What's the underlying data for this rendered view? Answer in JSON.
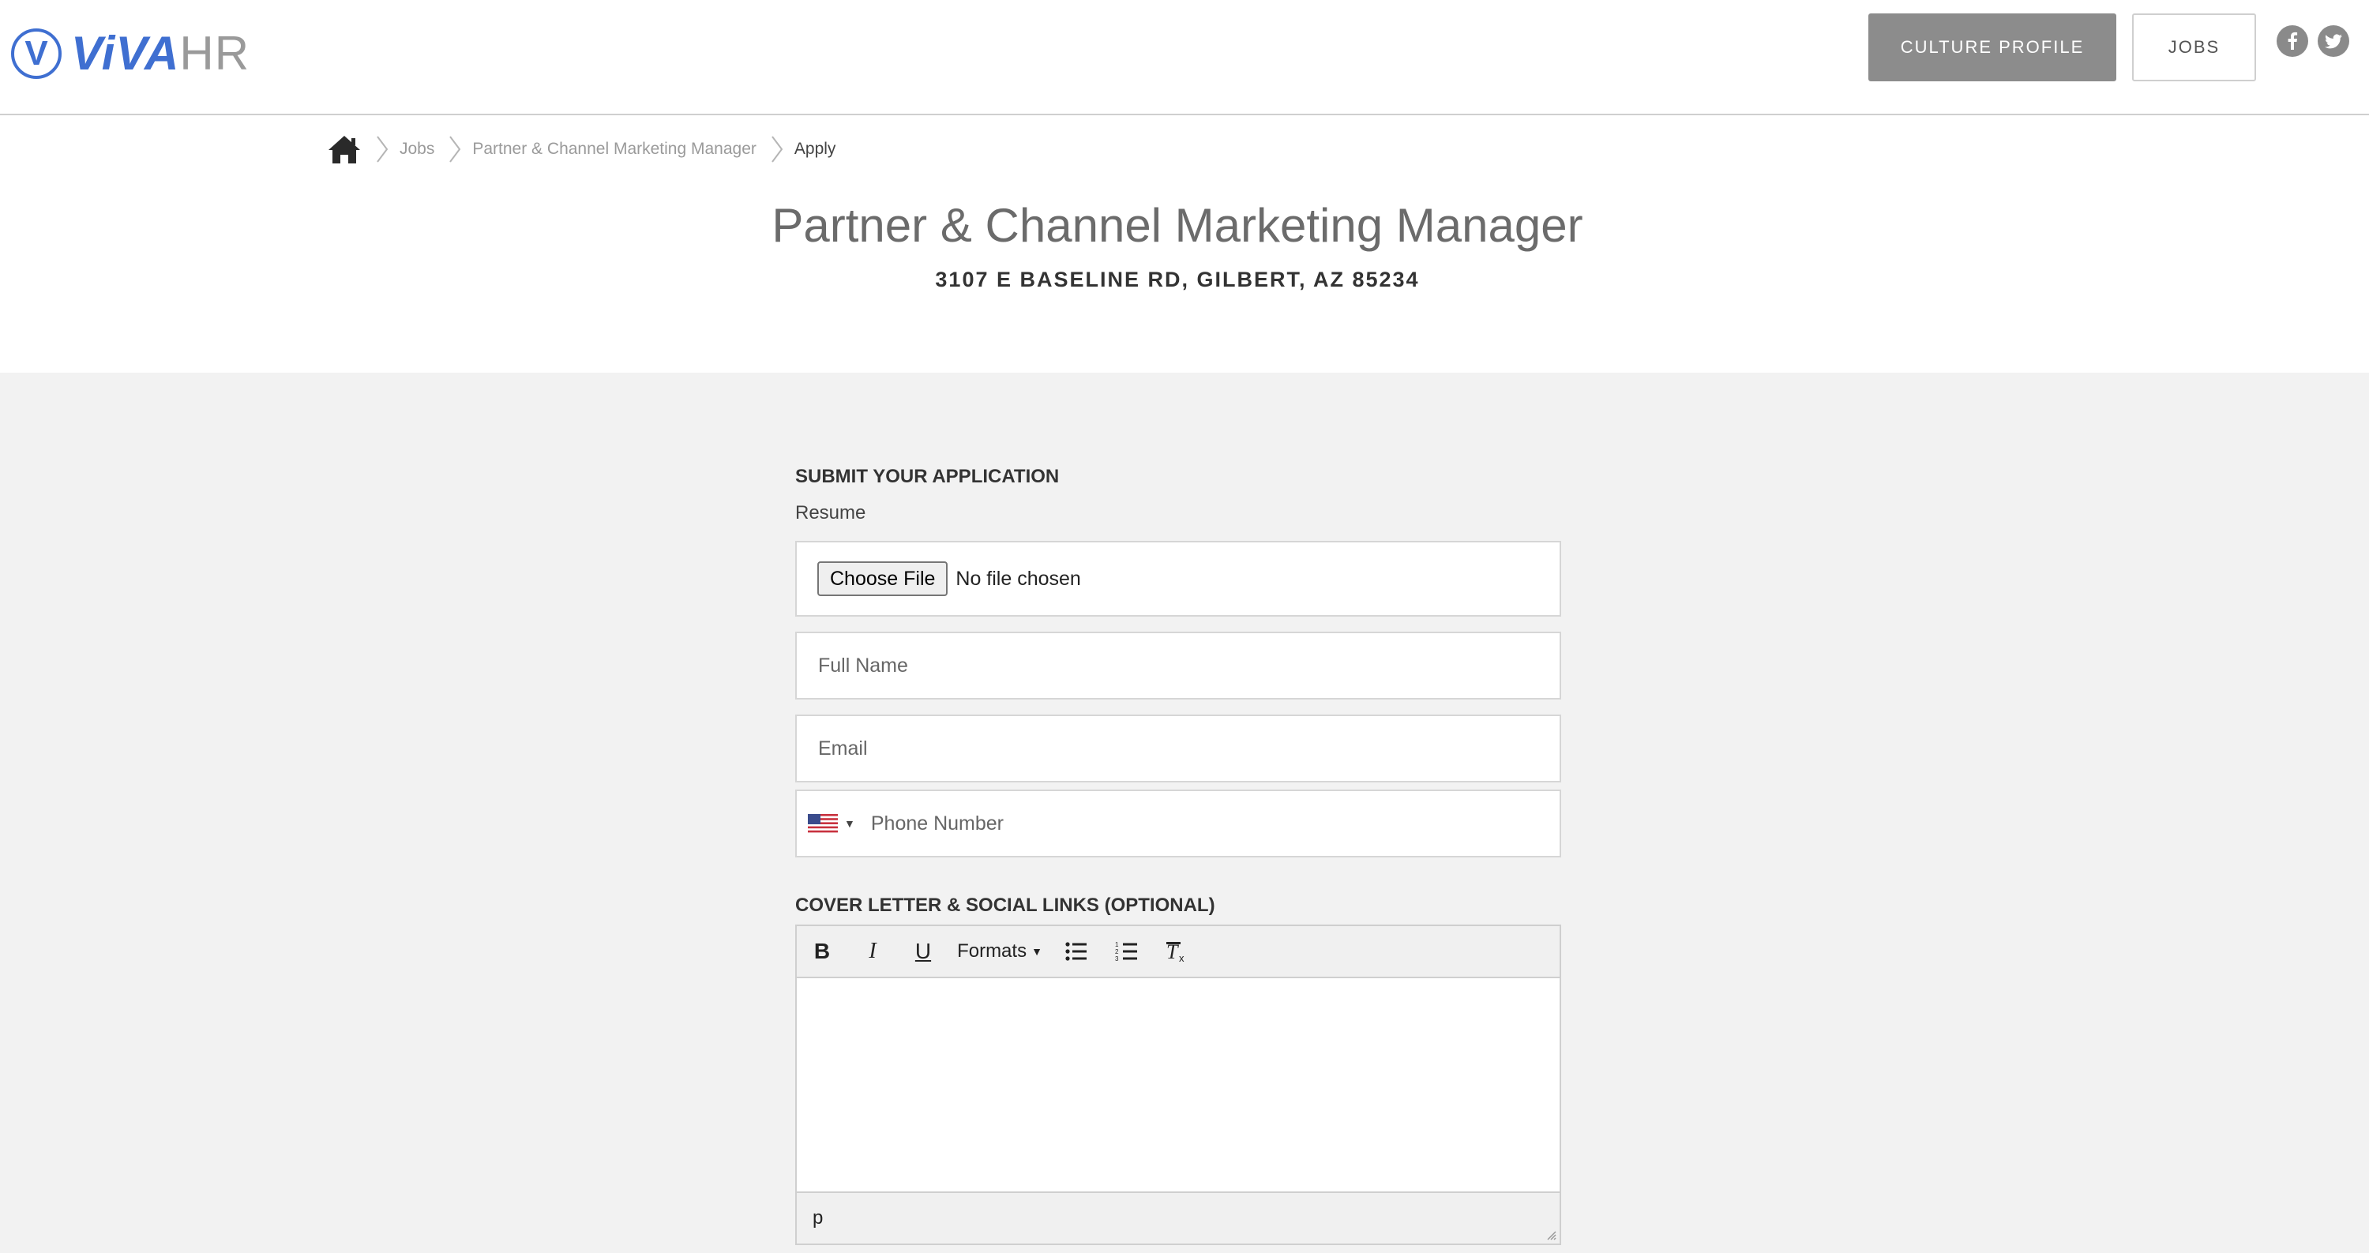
{
  "header": {
    "logo_text_main": "ViVA",
    "logo_text_suffix": "HR",
    "logo_mark": "V",
    "nav": {
      "culture_profile": "CULTURE PROFILE",
      "jobs": "JOBS"
    },
    "social_icons": [
      "facebook-icon",
      "twitter-icon"
    ]
  },
  "breadcrumb": {
    "home_icon": "home-icon",
    "items": [
      "Jobs",
      "Partner & Channel Marketing Manager",
      "Apply"
    ]
  },
  "job": {
    "title": "Partner & Channel Marketing Manager",
    "address": "3107 E BASELINE RD, GILBERT, AZ 85234"
  },
  "form": {
    "section_title": "SUBMIT YOUR APPLICATION",
    "resume_label": "Resume",
    "file_button": "Choose File",
    "file_status": "No file chosen",
    "full_name_placeholder": "Full Name",
    "email_placeholder": "Email",
    "phone_placeholder": "Phone Number",
    "phone_country_flag": "us-flag-icon",
    "cover_letter_title": "COVER LETTER & SOCIAL LINKS (OPTIONAL)",
    "editor": {
      "toolbar": {
        "bold": "B",
        "italic": "I",
        "underline": "U",
        "formats": "Formats",
        "bullet_list_icon": "bullet-list-icon",
        "numbered_list_icon": "numbered-list-icon",
        "clear_format_icon": "clear-format-icon"
      },
      "status_path": "p"
    }
  },
  "colors": {
    "brand_blue": "#3f6fd1",
    "page_background": "#f2f2f2",
    "culture_button": "#8c8c8c"
  }
}
